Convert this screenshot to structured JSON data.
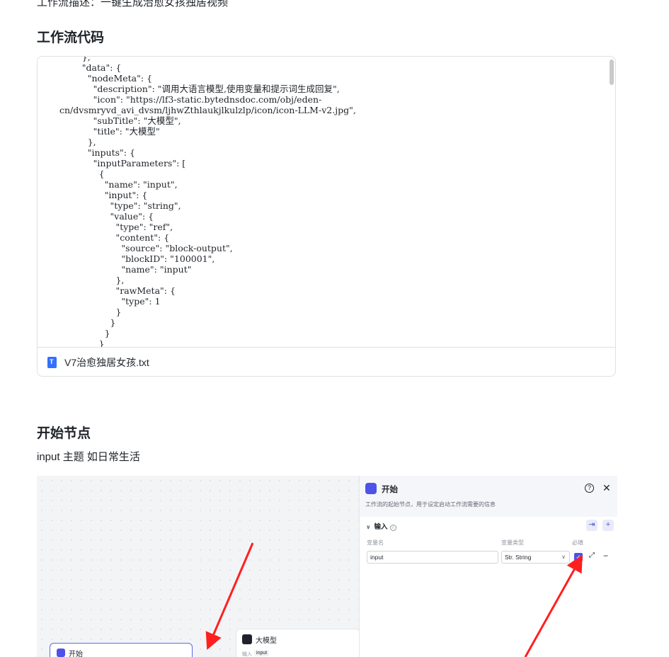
{
  "top_description": "工作流描述：一键生成治愈女孩独居视频",
  "section_code": {
    "title": "工作流代码"
  },
  "code_lines": [
    "        },",
    "        \"data\": {",
    "          \"nodeMeta\": {",
    "            \"description\": \"调用大语言模型,使用变量和提示词生成回复\",",
    "            \"icon\": \"https://lf3-static.bytednsdoc.com/obj/eden-",
    "cn/dvsmryvd_avi_dvsm/ljhwZthlaukjlkulzlp/icon/icon-LLM-v2.jpg\",",
    "            \"subTitle\": \"大模型\",",
    "            \"title\": \"大模型\"",
    "          },",
    "          \"inputs\": {",
    "            \"inputParameters\": [",
    "              {",
    "                \"name\": \"input\",",
    "                \"input\": {",
    "                  \"type\": \"string\",",
    "                  \"value\": {",
    "                    \"type\": \"ref\",",
    "                    \"content\": {",
    "                      \"source\": \"block-output\",",
    "                      \"blockID\": \"100001\",",
    "                      \"name\": \"input\"",
    "                    },",
    "                    \"rawMeta\": {",
    "                      \"type\": 1",
    "                    }",
    "                  }",
    "                }",
    "              }"
  ],
  "attachment": {
    "file_name": "V7治愈独居女孩.txt",
    "icon": "text-file-icon"
  },
  "section_start": {
    "title": "开始节点",
    "text": "input 主题 如日常生活"
  },
  "screenshot": {
    "canvas": {
      "start_node_title": "开始",
      "llm_node_title": "大模型",
      "llm_input_label": "输入",
      "llm_input_chip": "input"
    },
    "panel": {
      "title": "开始",
      "description": "工作流的起始节点，用于设定启动工作流需要的信息",
      "section_label": "输入",
      "col_name": "变量名",
      "col_type": "变量类型",
      "col_required": "必填",
      "name_value": "input",
      "type_value": "Str. String",
      "required_checked": true
    },
    "accent_color": "#4d53e8",
    "arrow_color": "#ff1f1f"
  }
}
